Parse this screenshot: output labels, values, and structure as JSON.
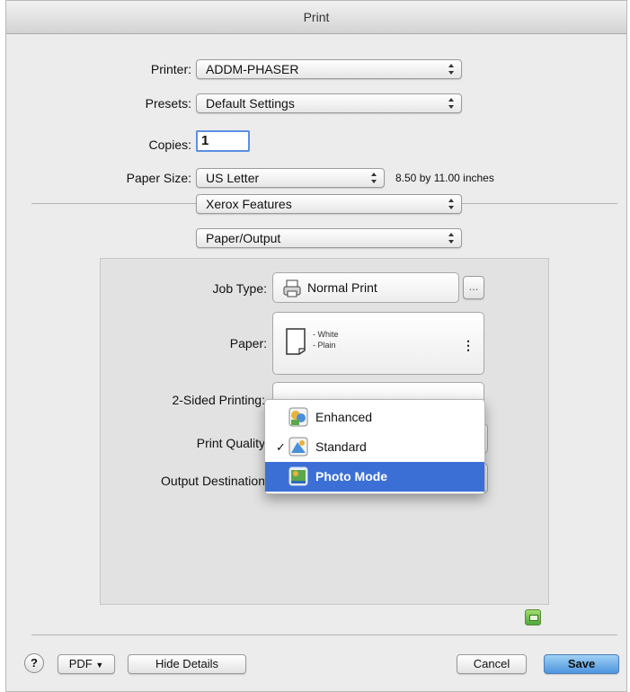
{
  "window": {
    "title": "Print"
  },
  "printer": {
    "label": "Printer:",
    "value": "ADDM-PHASER"
  },
  "presets": {
    "label": "Presets:",
    "value": "Default Settings"
  },
  "copies": {
    "label": "Copies:",
    "value": "1"
  },
  "paper_size": {
    "label": "Paper Size:",
    "value": "US Letter",
    "dimensions": "8.50 by 11.00 inches"
  },
  "feature_set": {
    "value": "Xerox Features"
  },
  "section": {
    "value": "Paper/Output"
  },
  "job_type": {
    "label": "Job Type:",
    "value": "Normal Print",
    "more_label": "..."
  },
  "paper": {
    "label": "Paper:",
    "line1": "- White",
    "line2": "- Plain"
  },
  "two_sided": {
    "label": "2-Sided Printing:"
  },
  "print_quality": {
    "label": "Print Quality",
    "options": [
      {
        "label": "Enhanced",
        "checked": ""
      },
      {
        "label": "Standard",
        "checked": "✓"
      },
      {
        "label": "Photo Mode",
        "checked": ""
      }
    ],
    "highlighted": "Photo Mode"
  },
  "output_destination": {
    "label": "Output Destination"
  },
  "footer": {
    "help_label": "?",
    "pdf_label": "PDF",
    "hide_details_label": "Hide Details",
    "cancel_label": "Cancel",
    "save_label": "Save"
  },
  "colors": {
    "accent": "#3b6fd6",
    "default_button": "#4d95df"
  }
}
